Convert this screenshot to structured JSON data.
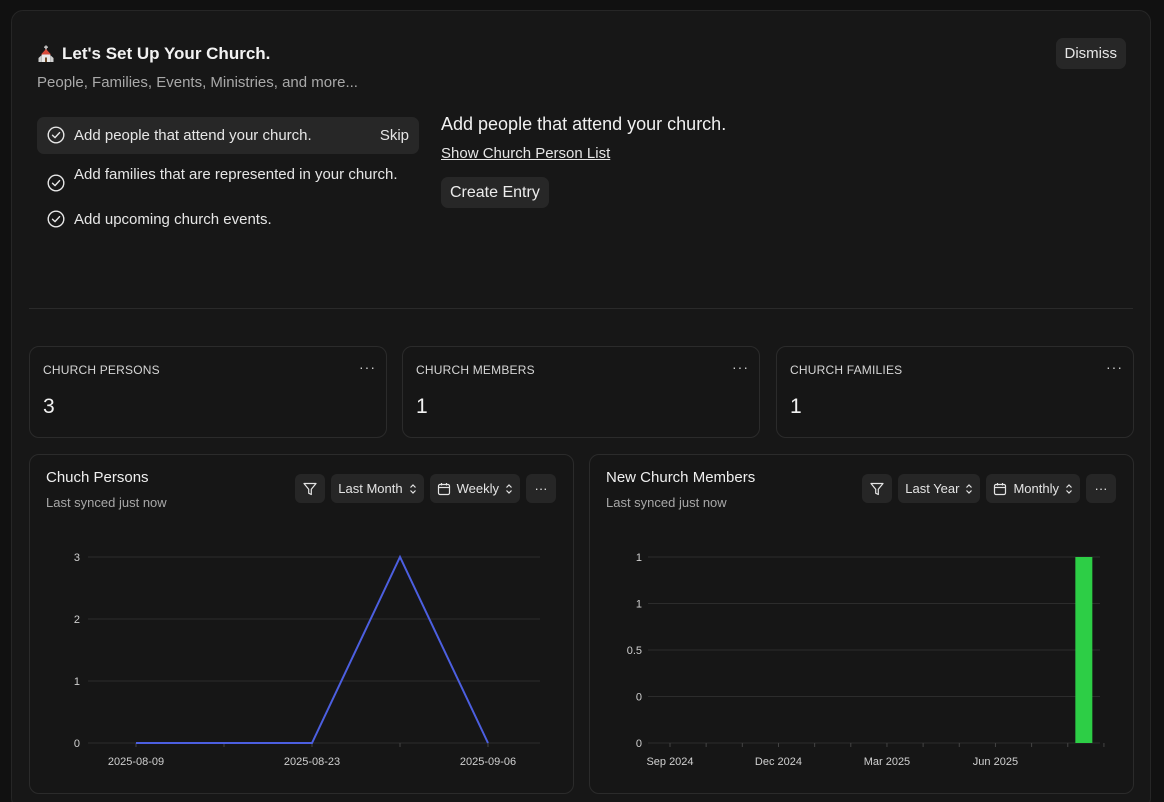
{
  "onboarding": {
    "title": "Let's Set Up Your Church.",
    "subtitle": "People, Families, Events, Ministries, and more...",
    "dismiss_label": "Dismiss",
    "steps": [
      {
        "label": "Add people that attend your church.",
        "action": "Skip",
        "active": true
      },
      {
        "label": "Add families that are represented in your church.",
        "action": "",
        "active": false
      },
      {
        "label": "Add upcoming church events.",
        "action": "",
        "active": false
      }
    ],
    "detail": {
      "heading": "Add people that attend your church.",
      "link_label": "Show Church Person List",
      "button_label": "Create Entry"
    }
  },
  "stats": [
    {
      "label": "CHURCH PERSONS",
      "value": "3",
      "menu": "···"
    },
    {
      "label": "CHURCH MEMBERS",
      "value": "1",
      "menu": "···"
    },
    {
      "label": "CHURCH FAMILIES",
      "value": "1",
      "menu": "···"
    }
  ],
  "charts": [
    {
      "title": "Chuch Persons",
      "subtitle": "Last synced just now",
      "range_label": "Last Month",
      "interval_label": "Weekly",
      "menu": "···"
    },
    {
      "title": "New Church Members",
      "subtitle": "Last synced just now",
      "range_label": "Last Year",
      "interval_label": "Monthly",
      "menu": "···"
    }
  ],
  "colors": {
    "line": "#4c5fe0",
    "bar": "#2dce46"
  },
  "chart_data": [
    {
      "type": "line",
      "title": "Chuch Persons",
      "x": [
        "2025-08-09",
        "2025-08-16",
        "2025-08-23",
        "2025-08-30",
        "2025-09-06"
      ],
      "x_tick_labels": [
        "2025-08-09",
        "2025-08-23",
        "2025-09-06"
      ],
      "series": [
        {
          "values": [
            0,
            0,
            0,
            3,
            0
          ]
        }
      ],
      "y_ticks": [
        "0",
        "1",
        "2",
        "3"
      ],
      "ylim": [
        0,
        3
      ],
      "grid": true
    },
    {
      "type": "bar",
      "title": "New Church Members",
      "categories": [
        "Sep 2024",
        "Oct 2024",
        "Nov 2024",
        "Dec 2024",
        "Jan 2025",
        "Feb 2025",
        "Mar 2025",
        "Apr 2025",
        "May 2025",
        "Jun 2025",
        "Jul 2025",
        "Aug 2025",
        "Sep 2025"
      ],
      "x_tick_labels": [
        "Sep 2024",
        "Dec 2024",
        "Mar 2025",
        "Jun 2025"
      ],
      "values": [
        0,
        0,
        0,
        0,
        0,
        0,
        0,
        0,
        0,
        0,
        0,
        1,
        0
      ],
      "y_ticks": [
        "0",
        "0",
        "0.5",
        "1",
        "1"
      ],
      "ylim": [
        0,
        1
      ],
      "grid": true
    }
  ]
}
